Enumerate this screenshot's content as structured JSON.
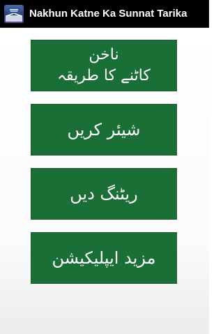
{
  "app": {
    "title": "Nakhun Katne Ka Sunnat Tarika",
    "icon": "book-app-icon"
  },
  "menu": {
    "items": [
      {
        "label": "ناخن\nکاٹنے کا طریقہ"
      },
      {
        "label": "شیئر کریں"
      },
      {
        "label": "ریٹنگ دیں"
      },
      {
        "label": "مزید ایپلیکیشن"
      }
    ]
  },
  "colors": {
    "action_bar": "#000000",
    "button_green": "#1a6f36",
    "button_text": "#ffffff"
  }
}
